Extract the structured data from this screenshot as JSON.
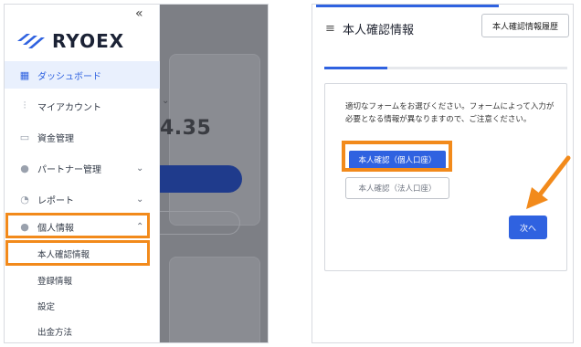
{
  "colors": {
    "accent": "#2f62e0",
    "highlight": "#f28a1b",
    "overlay": "#7d7f85"
  },
  "sidebar": {
    "collapse_icon": "double-chevron-left-icon",
    "logo_text": "RYOEX",
    "items": [
      {
        "label": "ダッシュボード",
        "icon": "dashboard-icon"
      },
      {
        "label": "マイアカウント",
        "icon": "accounts-icon"
      },
      {
        "label": "資金管理",
        "icon": "wallet-icon"
      },
      {
        "label": "パートナー管理",
        "icon": "partners-icon"
      },
      {
        "label": "レポート",
        "icon": "pie-chart-icon"
      },
      {
        "label": "個人情報",
        "icon": "user-icon"
      }
    ],
    "subitems": [
      "本人確認情報",
      "登録情報",
      "設定",
      "出金方法"
    ]
  },
  "background": {
    "amount": "4.35"
  },
  "right": {
    "title": "本人確認情報",
    "history_button": "本人確認情報履歴",
    "progress": 0.26,
    "description": "適切なフォームをお選びください。フォームによって入力が必要となる情報が異なりますので、ご注意ください。",
    "option_individual": "本人確認（個人口座）",
    "option_corporate": "本人確認（法人口座）",
    "next_button": "次へ"
  }
}
